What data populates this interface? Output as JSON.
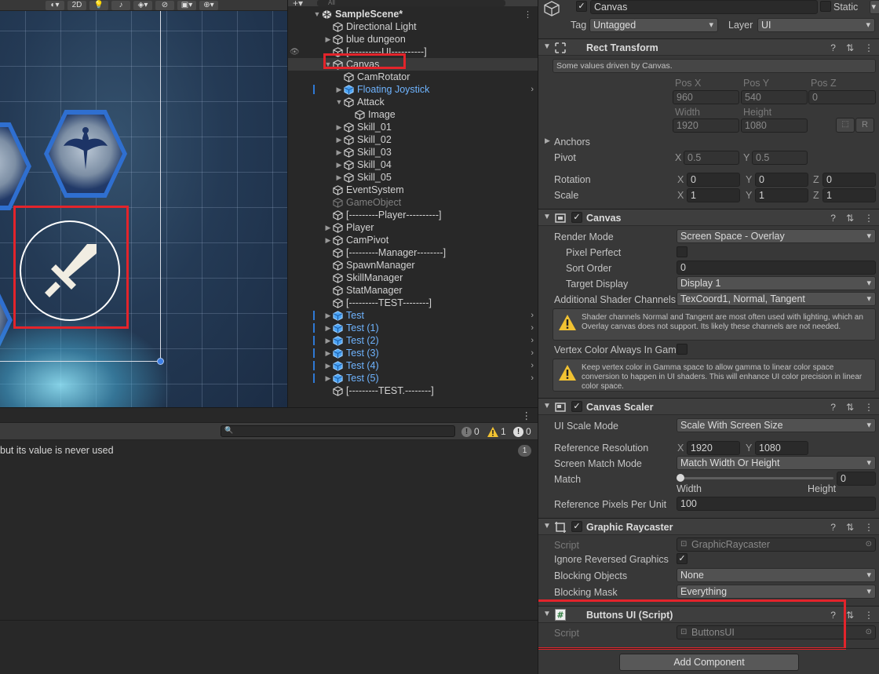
{
  "scene_toolbar": {
    "mode_2d": "2D"
  },
  "hierarchy": {
    "search_placeholder": "All",
    "scene_name": "SampleScene*",
    "items": [
      {
        "label": "Directional Light"
      },
      {
        "label": "blue dungeon"
      },
      {
        "label": "[----------UI----------]"
      },
      {
        "label": "Canvas"
      },
      {
        "label": "CamRotator"
      },
      {
        "label": "Floating Joystick"
      },
      {
        "label": "Attack"
      },
      {
        "label": "Image"
      },
      {
        "label": "Skill_01"
      },
      {
        "label": "Skill_02"
      },
      {
        "label": "Skill_03"
      },
      {
        "label": "Skill_04"
      },
      {
        "label": "Skill_05"
      },
      {
        "label": "EventSystem"
      },
      {
        "label": "GameObject"
      },
      {
        "label": "[---------Player----------]"
      },
      {
        "label": "Player"
      },
      {
        "label": "CamPivot"
      },
      {
        "label": "[---------Manager--------]"
      },
      {
        "label": "SpawnManager"
      },
      {
        "label": "SkillManager"
      },
      {
        "label": "StatManager"
      },
      {
        "label": "[---------TEST--------]"
      },
      {
        "label": "Test"
      },
      {
        "label": "Test (1)"
      },
      {
        "label": "Test (2)"
      },
      {
        "label": "Test (3)"
      },
      {
        "label": "Test (4)"
      },
      {
        "label": "Test (5)"
      },
      {
        "label": "[---------TEST.--------]"
      }
    ]
  },
  "console": {
    "error_count": "0",
    "warning_count": "1",
    "info_count": "0",
    "log_text": "but its value is never used",
    "log_count": "1"
  },
  "inspector": {
    "object_name": "Canvas",
    "static_label": "Static",
    "tag_label": "Tag",
    "tag_value": "Untagged",
    "layer_label": "Layer",
    "layer_value": "UI",
    "rect_transform": {
      "title": "Rect Transform",
      "driven_note": "Some values driven by Canvas.",
      "pos_x_label": "Pos X",
      "pos_y_label": "Pos Y",
      "pos_z_label": "Pos Z",
      "pos_x": "960",
      "pos_y": "540",
      "pos_z": "0",
      "width_label": "Width",
      "height_label": "Height",
      "width": "1920",
      "height": "1080",
      "raw_button": "R",
      "anchors_label": "Anchors",
      "pivot_label": "Pivot",
      "pivot_x": "0.5",
      "pivot_y": "0.5",
      "rotation_label": "Rotation",
      "rot_x": "0",
      "rot_y": "0",
      "rot_z": "0",
      "scale_label": "Scale",
      "scale_x": "1",
      "scale_y": "1",
      "scale_z": "1",
      "x": "X",
      "y": "Y",
      "z": "Z"
    },
    "canvas": {
      "title": "Canvas",
      "render_mode_label": "Render Mode",
      "render_mode": "Screen Space - Overlay",
      "pixel_perfect_label": "Pixel Perfect",
      "sort_order_label": "Sort Order",
      "sort_order": "0",
      "target_display_label": "Target Display",
      "target_display": "Display 1",
      "shader_channels_label": "Additional Shader Channels",
      "shader_channels": "TexCoord1, Normal, Tangent",
      "warning_1": "Shader channels Normal and Tangent are most often used with lighting, which an Overlay canvas does not support. Its likely these channels are not needed.",
      "vertex_color_label": "Vertex Color Always In Gam",
      "warning_2": "Keep vertex color in Gamma space to allow gamma to linear color space conversion to happen in UI shaders. This will enhance UI color precision in linear color space."
    },
    "canvas_scaler": {
      "title": "Canvas Scaler",
      "ui_scale_mode_label": "UI Scale Mode",
      "ui_scale_mode": "Scale With Screen Size",
      "ref_res_label": "Reference Resolution",
      "ref_x": "1920",
      "ref_y": "1080",
      "match_mode_label": "Screen Match Mode",
      "match_mode": "Match Width Or Height",
      "match_label": "Match",
      "match_value": "0",
      "match_fraction": 0,
      "width_label": "Width",
      "height_label": "Height",
      "ref_ppu_label": "Reference Pixels Per Unit",
      "ref_ppu": "100"
    },
    "graphic_raycaster": {
      "title": "Graphic Raycaster",
      "script_label": "Script",
      "script_value": "GraphicRaycaster",
      "ignore_reversed_label": "Ignore Reversed Graphics",
      "blocking_objects_label": "Blocking Objects",
      "blocking_objects": "None",
      "blocking_mask_label": "Blocking Mask",
      "blocking_mask": "Everything"
    },
    "buttons_ui": {
      "title": "Buttons UI (Script)",
      "script_label": "Script",
      "script_value": "ButtonsUI"
    },
    "add_component": "Add Component"
  },
  "colors": {
    "prefab_blue": "#6fb4ff",
    "highlight_red": "#e3242b",
    "ui_blue": "#2f6fd0"
  }
}
